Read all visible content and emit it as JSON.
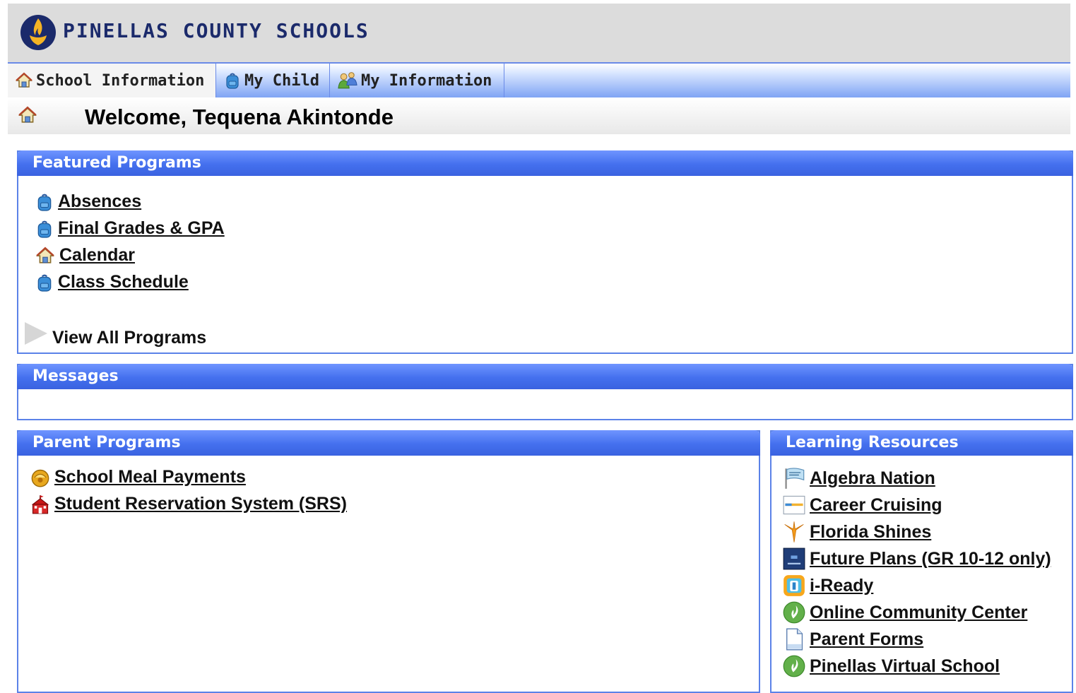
{
  "brand": {
    "logo_text": "PINELLAS COUNTY SCHOOLS",
    "logo_icon": "torch-logo-icon",
    "colors": {
      "navy": "#1b2a6b",
      "flame": "#f5b324",
      "accent_blue": "#4470ee"
    }
  },
  "tabs": [
    {
      "label": "School Information",
      "icon": "house-icon"
    },
    {
      "label": "My Child",
      "icon": "backpack-icon"
    },
    {
      "label": "My Information",
      "icon": "people-icon"
    }
  ],
  "welcome": {
    "text": "Welcome, Tequena Akintonde",
    "icon": "house-icon"
  },
  "featured_programs": {
    "title": "Featured Programs",
    "items": [
      {
        "label": "Absences",
        "icon": "backpack-icon"
      },
      {
        "label": "Final Grades & GPA",
        "icon": "backpack-icon"
      },
      {
        "label": "Calendar",
        "icon": "house-icon"
      },
      {
        "label": "Class Schedule",
        "icon": "backpack-icon"
      }
    ],
    "view_all": "View All Programs"
  },
  "messages": {
    "title": "Messages"
  },
  "parent_programs": {
    "title": "Parent Programs",
    "items": [
      {
        "label": "School Meal Payments",
        "icon": "meal-icon"
      },
      {
        "label": "Student Reservation System (SRS)",
        "icon": "schoolhouse-icon"
      }
    ]
  },
  "learning_resources": {
    "title": "Learning Resources",
    "items": [
      {
        "label": "Algebra Nation",
        "icon": "flag-icon"
      },
      {
        "label": "Career Cruising",
        "icon": "career-icon"
      },
      {
        "label": "Florida Shines",
        "icon": "star-burst-icon"
      },
      {
        "label": "Future Plans (GR 10-12 only)",
        "icon": "future-plans-icon"
      },
      {
        "label": "i-Ready",
        "icon": "iready-icon"
      },
      {
        "label": "Online Community Center",
        "icon": "pcs-leaf-icon"
      },
      {
        "label": "Parent Forms",
        "icon": "document-icon"
      },
      {
        "label": "Pinellas Virtual School",
        "icon": "pcs-leaf-icon"
      }
    ]
  }
}
